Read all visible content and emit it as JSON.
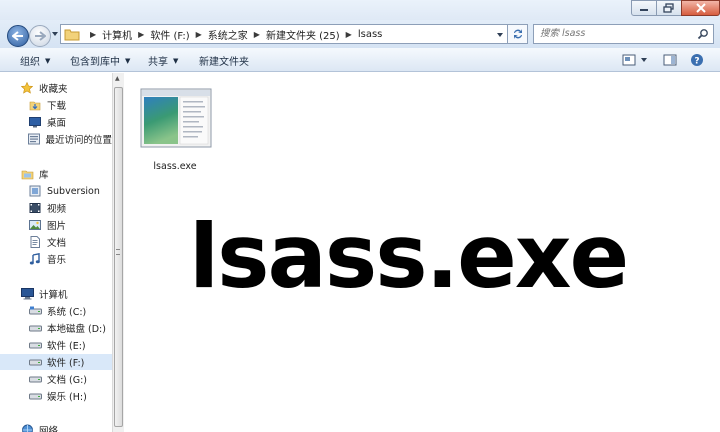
{
  "address": {
    "crumbs": [
      "计算机",
      "软件 (F:)",
      "系统之家",
      "新建文件夹 (25)",
      "lsass"
    ]
  },
  "search": {
    "placeholder": "搜索 lsass"
  },
  "toolbar": {
    "organize": "组织",
    "include_in_library": "包含到库中",
    "share": "共享",
    "new_folder": "新建文件夹"
  },
  "nav": {
    "favorites": "收藏夹",
    "downloads": "下载",
    "desktop": "桌面",
    "recent": "最近访问的位置",
    "libraries": "库",
    "subversion": "Subversion",
    "videos": "视频",
    "pictures": "图片",
    "documents": "文档",
    "music": "音乐",
    "computer": "计算机",
    "drive_c": "系统 (C:)",
    "drive_d": "本地磁盘 (D:)",
    "drive_e": "软件 (E:)",
    "drive_f": "软件 (F:)",
    "drive_g": "文档 (G:)",
    "drive_h": "娱乐 (H:)",
    "network": "网络"
  },
  "content": {
    "file_name": "lsass.exe",
    "overlay_title": "lsass.exe"
  },
  "colors": {
    "selection": "#d9e8f9",
    "toolbar_text": "#1e2f45",
    "close_button": "#d65c3e"
  }
}
